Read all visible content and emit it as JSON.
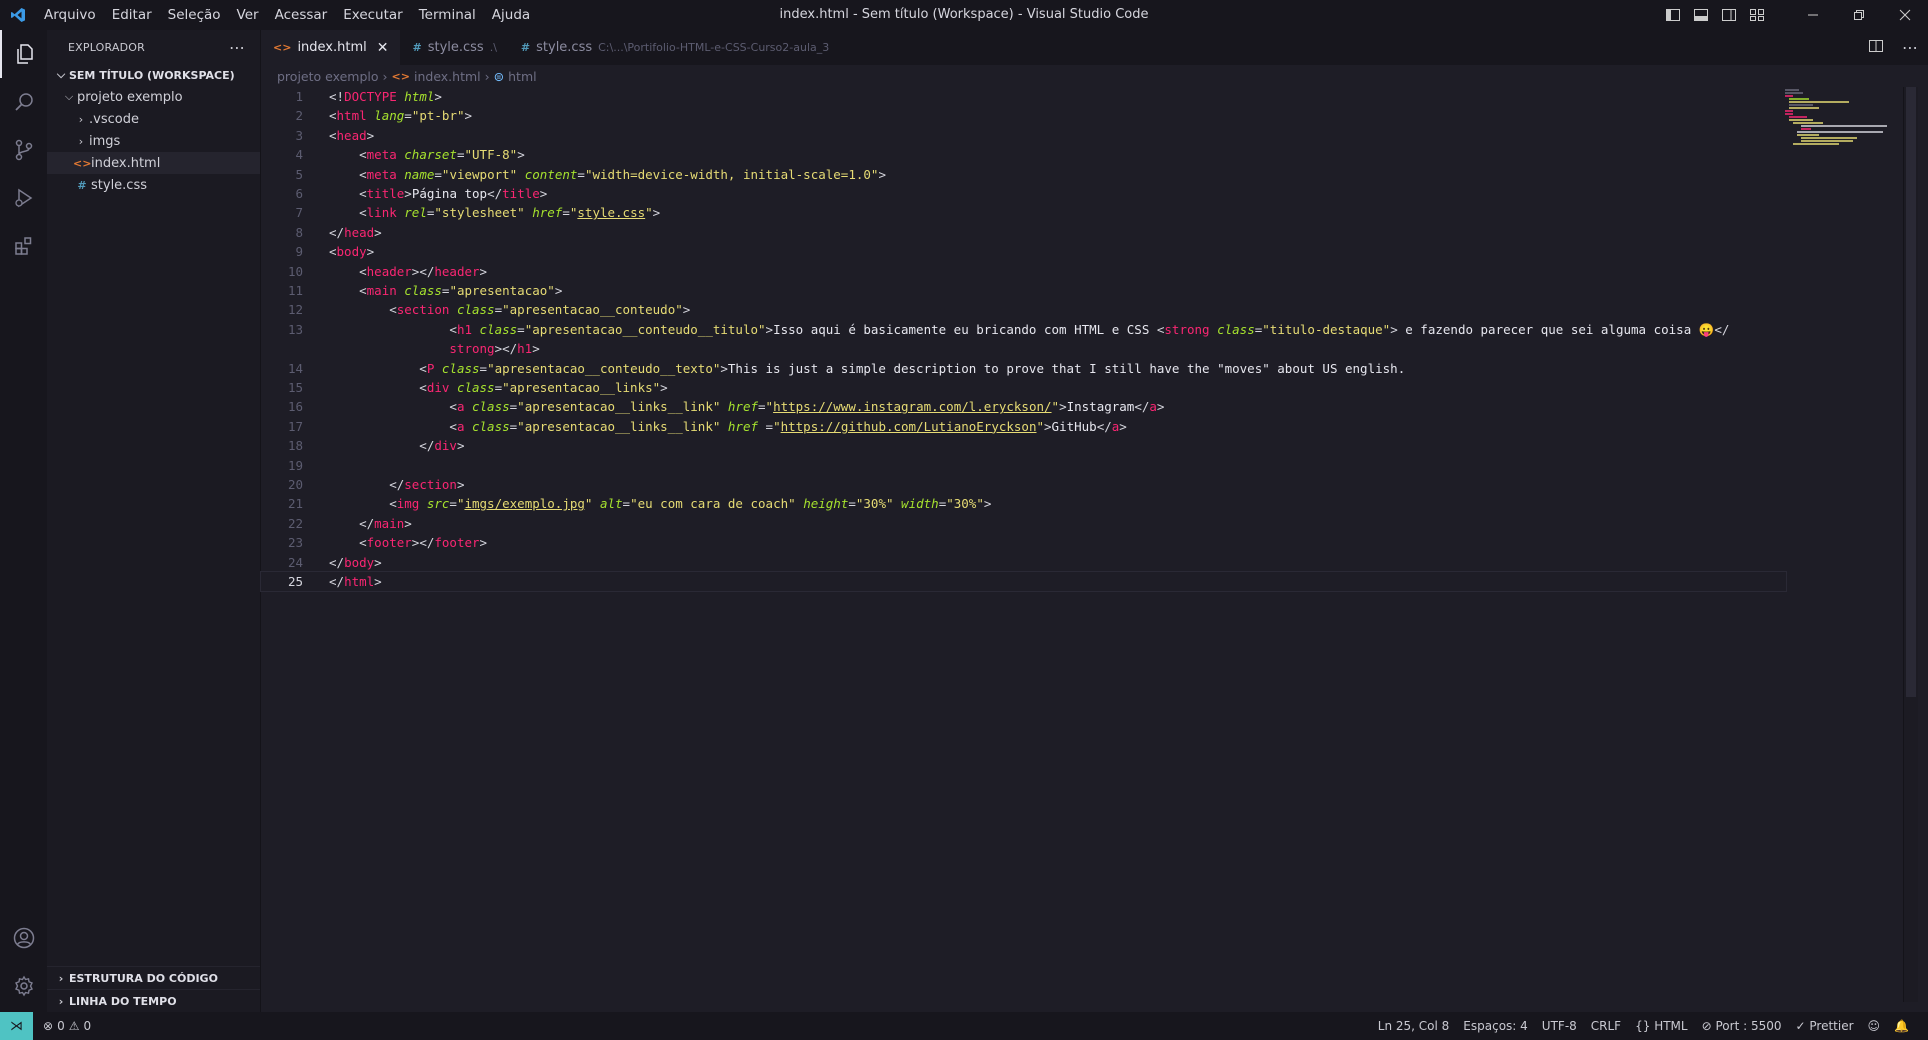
{
  "titlebar": {
    "menu": [
      "Arquivo",
      "Editar",
      "Seleção",
      "Ver",
      "Acessar",
      "Executar",
      "Terminal",
      "Ajuda"
    ],
    "window_title": "index.html - Sem título (Workspace) - Visual Studio Code"
  },
  "activity": [
    "explorer-icon",
    "search-icon",
    "source-control-icon",
    "run-debug-icon",
    "extensions-icon",
    "account-icon",
    "gear-icon"
  ],
  "sidebar": {
    "title": "EXPLORADOR",
    "workspace": "SEM TÍTULO (WORKSPACE)",
    "folder": "projeto exemplo",
    "items": [
      {
        "label": ".vscode",
        "kind": "folder"
      },
      {
        "label": "imgs",
        "kind": "folder"
      },
      {
        "label": "index.html",
        "kind": "html"
      },
      {
        "label": "style.css",
        "kind": "css"
      }
    ],
    "sections": [
      "ESTRUTURA DO CÓDIGO",
      "LINHA DO TEMPO"
    ]
  },
  "tabs": [
    {
      "label": "index.html",
      "kind": "html",
      "active": true
    },
    {
      "label": "style.css",
      "kind": "css",
      "path": ".\\"
    },
    {
      "label": "style.css",
      "kind": "css",
      "path": "C:\\...\\Portifolio-HTML-e-CSS-Curso2-aula_3"
    }
  ],
  "breadcrumb": [
    "projeto exemplo",
    "index.html",
    "html"
  ],
  "editor": {
    "current_line": 25,
    "lines": [
      {
        "n": "1",
        "t": [
          [
            "p",
            "<!"
          ],
          [
            "tag",
            "DOCTYPE"
          ],
          [
            "p",
            " "
          ],
          [
            "attr",
            "html"
          ],
          [
            "p",
            ">"
          ]
        ]
      },
      {
        "n": "2",
        "t": [
          [
            "p",
            "<"
          ],
          [
            "tag",
            "html"
          ],
          [
            "p",
            " "
          ],
          [
            "attr",
            "lang"
          ],
          [
            "p",
            "="
          ],
          [
            "str",
            "\"pt-br\""
          ],
          [
            "p",
            ">"
          ]
        ]
      },
      {
        "n": "3",
        "t": [
          [
            "p",
            "<"
          ],
          [
            "tag",
            "head"
          ],
          [
            "p",
            ">"
          ]
        ]
      },
      {
        "n": "4",
        "t": [
          [
            "p",
            "    <"
          ],
          [
            "tag",
            "meta"
          ],
          [
            "p",
            " "
          ],
          [
            "attr",
            "charset"
          ],
          [
            "p",
            "="
          ],
          [
            "str",
            "\"UTF-8\""
          ],
          [
            "p",
            ">"
          ]
        ]
      },
      {
        "n": "5",
        "t": [
          [
            "p",
            "    <"
          ],
          [
            "tag",
            "meta"
          ],
          [
            "p",
            " "
          ],
          [
            "attr",
            "name"
          ],
          [
            "p",
            "="
          ],
          [
            "str",
            "\"viewport\""
          ],
          [
            "p",
            " "
          ],
          [
            "attr",
            "content"
          ],
          [
            "p",
            "="
          ],
          [
            "str",
            "\"width=device-width, initial-scale=1.0\""
          ],
          [
            "p",
            ">"
          ]
        ]
      },
      {
        "n": "6",
        "t": [
          [
            "p",
            "    <"
          ],
          [
            "tag",
            "title"
          ],
          [
            "p",
            ">"
          ],
          [
            "txt",
            "Página top"
          ],
          [
            "p",
            "</"
          ],
          [
            "tag",
            "title"
          ],
          [
            "p",
            ">"
          ]
        ]
      },
      {
        "n": "7",
        "t": [
          [
            "p",
            "    <"
          ],
          [
            "tag",
            "link"
          ],
          [
            "p",
            " "
          ],
          [
            "attr",
            "rel"
          ],
          [
            "p",
            "="
          ],
          [
            "str",
            "\"stylesheet\""
          ],
          [
            "p",
            " "
          ],
          [
            "attr",
            "href"
          ],
          [
            "p",
            "="
          ],
          [
            "str",
            "\""
          ],
          [
            "url",
            "style.css"
          ],
          [
            "str",
            "\""
          ],
          [
            "p",
            ">"
          ]
        ]
      },
      {
        "n": "8",
        "t": [
          [
            "p",
            "</"
          ],
          [
            "tag",
            "head"
          ],
          [
            "p",
            ">"
          ]
        ]
      },
      {
        "n": "9",
        "t": [
          [
            "p",
            "<"
          ],
          [
            "tag",
            "body"
          ],
          [
            "p",
            ">"
          ]
        ]
      },
      {
        "n": "10",
        "t": [
          [
            "p",
            "    <"
          ],
          [
            "tag",
            "header"
          ],
          [
            "p",
            "></"
          ],
          [
            "tag",
            "header"
          ],
          [
            "p",
            ">"
          ]
        ]
      },
      {
        "n": "11",
        "t": [
          [
            "p",
            "    <"
          ],
          [
            "tag",
            "main"
          ],
          [
            "p",
            " "
          ],
          [
            "attr",
            "class"
          ],
          [
            "p",
            "="
          ],
          [
            "str",
            "\"apresentacao\""
          ],
          [
            "p",
            ">"
          ]
        ]
      },
      {
        "n": "12",
        "t": [
          [
            "p",
            "        <"
          ],
          [
            "tag",
            "section"
          ],
          [
            "p",
            " "
          ],
          [
            "attr",
            "class"
          ],
          [
            "p",
            "="
          ],
          [
            "str",
            "\"apresentacao__conteudo\""
          ],
          [
            "p",
            ">"
          ]
        ]
      },
      {
        "n": "13",
        "t": [
          [
            "p",
            "                <"
          ],
          [
            "tag",
            "h1"
          ],
          [
            "p",
            " "
          ],
          [
            "attr",
            "class"
          ],
          [
            "p",
            "="
          ],
          [
            "str",
            "\"apresentacao__conteudo__titulo\""
          ],
          [
            "p",
            ">"
          ],
          [
            "txt",
            "Isso aqui é basicamente eu bricando com HTML e CSS "
          ],
          [
            "p",
            "<"
          ],
          [
            "tag",
            "strong"
          ],
          [
            "p",
            " "
          ],
          [
            "attr",
            "class"
          ],
          [
            "p",
            "="
          ],
          [
            "str",
            "\"titulo-destaque\""
          ],
          [
            "p",
            ">"
          ],
          [
            "txt",
            " e fazendo parecer que sei alguma coisa 😛"
          ],
          [
            "p",
            "</"
          ]
        ]
      },
      {
        "n": "",
        "t": [
          [
            "tag",
            "                strong"
          ],
          [
            "p",
            "></"
          ],
          [
            "tag",
            "h1"
          ],
          [
            "p",
            ">"
          ]
        ]
      },
      {
        "n": "14",
        "t": [
          [
            "p",
            "            <"
          ],
          [
            "tag",
            "P"
          ],
          [
            "p",
            " "
          ],
          [
            "attr",
            "class"
          ],
          [
            "p",
            "="
          ],
          [
            "str",
            "\"apresentacao__conteudo__texto\""
          ],
          [
            "p",
            ">"
          ],
          [
            "txt",
            "This is just a simple description to prove that I still have the \"moves\" about US english."
          ]
        ]
      },
      {
        "n": "15",
        "t": [
          [
            "p",
            "            <"
          ],
          [
            "tag",
            "div"
          ],
          [
            "p",
            " "
          ],
          [
            "attr",
            "class"
          ],
          [
            "p",
            "="
          ],
          [
            "str",
            "\"apresentacao__links\""
          ],
          [
            "p",
            ">"
          ]
        ]
      },
      {
        "n": "16",
        "t": [
          [
            "p",
            "                <"
          ],
          [
            "tag",
            "a"
          ],
          [
            "p",
            " "
          ],
          [
            "attr",
            "class"
          ],
          [
            "p",
            "="
          ],
          [
            "str",
            "\"apresentacao__links__link\""
          ],
          [
            "p",
            " "
          ],
          [
            "attr",
            "href"
          ],
          [
            "p",
            "="
          ],
          [
            "str",
            "\""
          ],
          [
            "url",
            "https://www.instagram.com/l.eryckson/"
          ],
          [
            "str",
            "\""
          ],
          [
            "p",
            ">"
          ],
          [
            "txt",
            "Instagram"
          ],
          [
            "p",
            "</"
          ],
          [
            "tag",
            "a"
          ],
          [
            "p",
            ">"
          ]
        ]
      },
      {
        "n": "17",
        "t": [
          [
            "p",
            "                <"
          ],
          [
            "tag",
            "a"
          ],
          [
            "p",
            " "
          ],
          [
            "attr",
            "class"
          ],
          [
            "p",
            "="
          ],
          [
            "str",
            "\"apresentacao__links__link\""
          ],
          [
            "p",
            " "
          ],
          [
            "attr",
            "href"
          ],
          [
            "p",
            " ="
          ],
          [
            "str",
            "\""
          ],
          [
            "url",
            "https://github.com/LutianoEryckson"
          ],
          [
            "str",
            "\""
          ],
          [
            "p",
            ">"
          ],
          [
            "txt",
            "GitHub"
          ],
          [
            "p",
            "</"
          ],
          [
            "tag",
            "a"
          ],
          [
            "p",
            ">"
          ]
        ]
      },
      {
        "n": "18",
        "t": [
          [
            "p",
            "            </"
          ],
          [
            "tag",
            "div"
          ],
          [
            "p",
            ">"
          ]
        ]
      },
      {
        "n": "19",
        "t": [
          [
            "p",
            ""
          ]
        ]
      },
      {
        "n": "20",
        "t": [
          [
            "p",
            "        </"
          ],
          [
            "tag",
            "section"
          ],
          [
            "p",
            ">"
          ]
        ]
      },
      {
        "n": "21",
        "t": [
          [
            "p",
            "        <"
          ],
          [
            "tag",
            "img"
          ],
          [
            "p",
            " "
          ],
          [
            "attr",
            "src"
          ],
          [
            "p",
            "="
          ],
          [
            "str",
            "\""
          ],
          [
            "url",
            "imgs/exemplo.jpg"
          ],
          [
            "str",
            "\""
          ],
          [
            "p",
            " "
          ],
          [
            "attr",
            "alt"
          ],
          [
            "p",
            "="
          ],
          [
            "str",
            "\"eu com cara de coach\""
          ],
          [
            "p",
            " "
          ],
          [
            "attr",
            "height"
          ],
          [
            "p",
            "="
          ],
          [
            "str",
            "\"30%\""
          ],
          [
            "p",
            " "
          ],
          [
            "attr",
            "width"
          ],
          [
            "p",
            "="
          ],
          [
            "str",
            "\"30%\""
          ],
          [
            "p",
            ">"
          ]
        ]
      },
      {
        "n": "22",
        "t": [
          [
            "p",
            "    </"
          ],
          [
            "tag",
            "main"
          ],
          [
            "p",
            ">"
          ]
        ]
      },
      {
        "n": "23",
        "t": [
          [
            "p",
            "    <"
          ],
          [
            "tag",
            "footer"
          ],
          [
            "p",
            "></"
          ],
          [
            "tag",
            "footer"
          ],
          [
            "p",
            ">"
          ]
        ]
      },
      {
        "n": "24",
        "t": [
          [
            "p",
            "</"
          ],
          [
            "tag",
            "body"
          ],
          [
            "p",
            ">"
          ]
        ]
      },
      {
        "n": "25",
        "t": [
          [
            "p",
            "</"
          ],
          [
            "tag",
            "html"
          ],
          [
            "p",
            ">"
          ]
        ]
      }
    ]
  },
  "statusbar": {
    "errors": "0",
    "warnings": "0",
    "position": "Ln 25, Col 8",
    "spaces": "Espaços: 4",
    "encoding": "UTF-8",
    "eol": "CRLF",
    "language": "HTML",
    "port": "Port : 5500",
    "prettier": "Prettier"
  },
  "colors": {
    "accent": "#4fc3c3",
    "tag": "#f92672",
    "attribute": "#a6e22e",
    "string": "#e6db74",
    "background": "#1e1d26"
  }
}
